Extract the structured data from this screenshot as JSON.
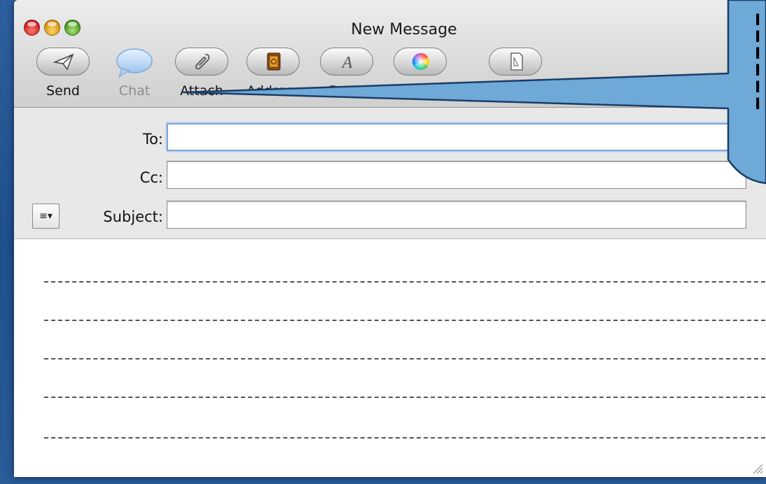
{
  "window": {
    "title": "New Message"
  },
  "toolbar": {
    "send": "Send",
    "chat": "Chat",
    "attach": "Attach",
    "address": "Address",
    "fonts": "Fonts",
    "colors": "Colors",
    "save_draft": "Save As Draft"
  },
  "header": {
    "to_label": "To:",
    "to_value": "",
    "cc_label": "Cc:",
    "cc_value": "",
    "subject_label": "Subject:",
    "subject_value": "",
    "menu_glyph": "≡▾"
  },
  "callout": {
    "lines": [
      "I",
      "I",
      "I",
      "I",
      "I",
      "I"
    ]
  },
  "colors": {
    "accent_focus": "#7aa6df",
    "callout_fill": "#6fa9d8"
  }
}
